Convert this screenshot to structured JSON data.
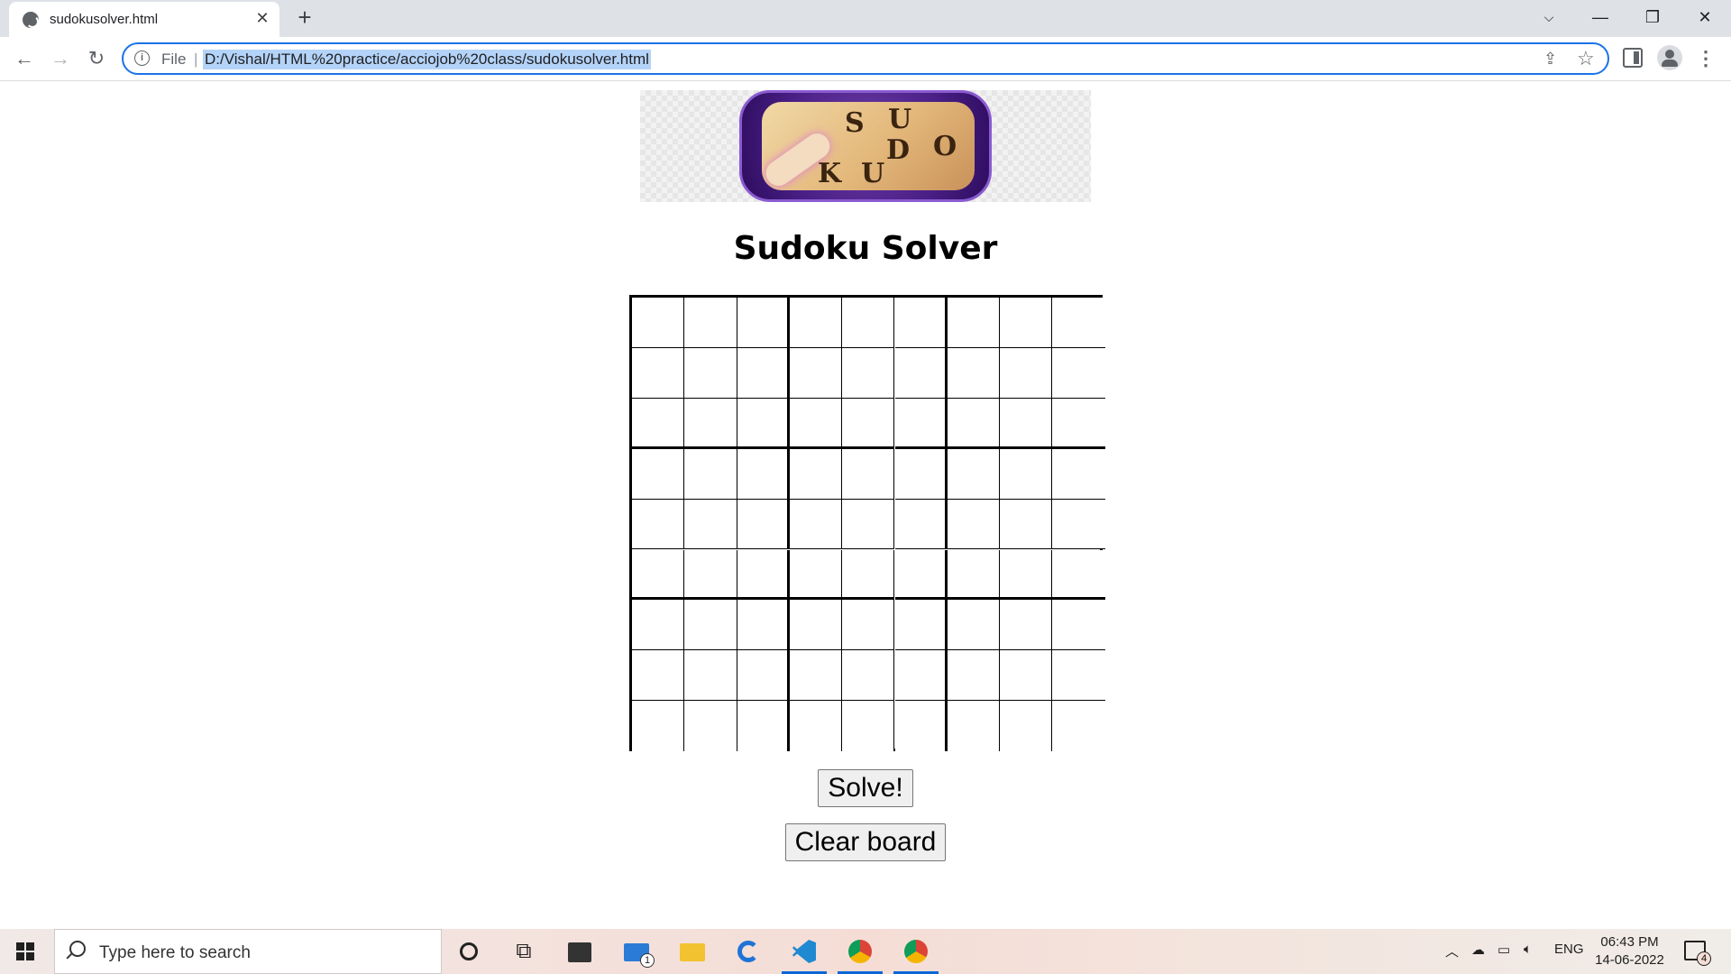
{
  "browser": {
    "tab_title": "sudokusolver.html",
    "new_tab_symbol": "+",
    "omnibox": {
      "scheme_label": "File",
      "url": "D:/Vishal/HTML%20practice/acciojob%20class/sudokusolver.html"
    }
  },
  "page": {
    "logo_letters": [
      "S",
      "U",
      "D",
      "O",
      "K",
      "U"
    ],
    "title": "Sudoku Solver",
    "grid": {
      "rows": 9,
      "cols": 9,
      "box_size": 3
    },
    "buttons": {
      "solve": "Solve!",
      "clear": "Clear board"
    }
  },
  "taskbar": {
    "search_placeholder": "Type here to search",
    "mail_badge": "1",
    "language": "ENG",
    "time": "06:43 PM",
    "date": "14-06-2022",
    "notification_count": "4"
  },
  "colors": {
    "omnibox_focus": "#1a73e8",
    "url_selection": "#b4d3f8",
    "taskbar_active": "#0b66d6"
  }
}
